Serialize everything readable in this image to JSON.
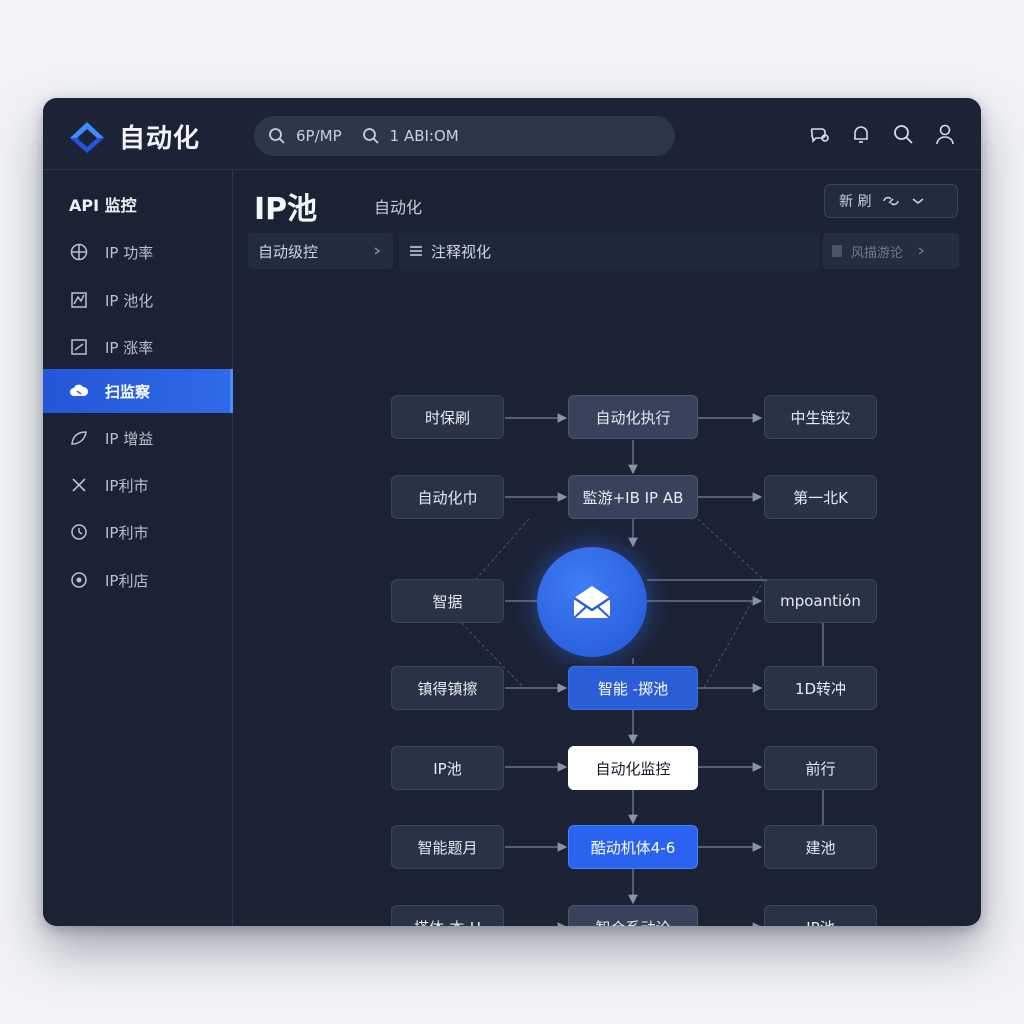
{
  "header": {
    "app_title": "自动化",
    "search_segments": [
      "6P/MP",
      "1 ABI:OM"
    ]
  },
  "sidebar": {
    "title": "API 监控",
    "items": [
      {
        "label": "IP 功率",
        "icon": "globe-icon"
      },
      {
        "label": "IP 池化",
        "icon": "chart-icon"
      },
      {
        "label": "IP 涨率",
        "icon": "trend-icon"
      },
      {
        "label": "扫监察",
        "icon": "cloud-icon",
        "active": true
      },
      {
        "label": "IP 增益",
        "icon": "leaf-icon"
      },
      {
        "label": "IP利市",
        "icon": "split-icon"
      },
      {
        "label": "IP利市",
        "icon": "clock-icon"
      },
      {
        "label": "IP利店",
        "icon": "circle-dot-icon"
      }
    ]
  },
  "main": {
    "title": "IP池",
    "subtitle": "自动化",
    "filter_label": "新 刷",
    "crumb_1": "自动级控",
    "crumb_2": "注释视化",
    "crumb_3": "风描游论"
  },
  "flow": {
    "left": [
      "时保刷",
      "自动化巾",
      "智据",
      "镇得镇擦",
      "IP池",
      "智能题月",
      "搭体-本-H"
    ],
    "mid": [
      "自动化执行",
      "監游+IB IP AB",
      "智能 -掷池",
      "自动化监控",
      "酷动机体4-6",
      "智合系动论"
    ],
    "right": [
      "中生链灾",
      "第一北K",
      "mpoantión",
      "1D转冲",
      "前行",
      "建池",
      "IP池"
    ]
  },
  "colors": {
    "accent": "#2f6ae8",
    "background": "#1b2234"
  }
}
